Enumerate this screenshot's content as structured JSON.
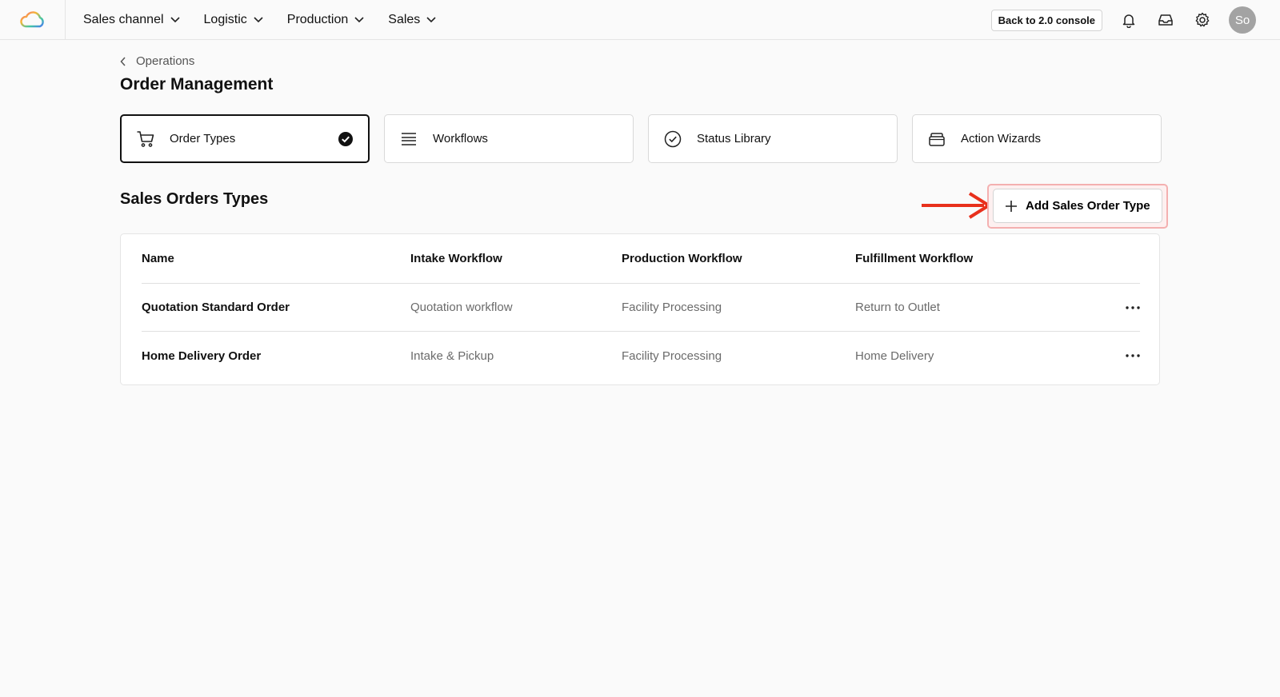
{
  "nav": {
    "items": [
      {
        "label": "Sales channel"
      },
      {
        "label": "Logistic"
      },
      {
        "label": "Production"
      },
      {
        "label": "Sales"
      }
    ],
    "console_button": "Back to 2.0 console",
    "avatar_initials": "So"
  },
  "breadcrumb": "Operations",
  "page_title": "Order Management",
  "cards": [
    {
      "label": "Order Types",
      "icon": "cart-icon",
      "active": true
    },
    {
      "label": "Workflows",
      "icon": "list-icon"
    },
    {
      "label": "Status Library",
      "icon": "check-circle-icon"
    },
    {
      "label": "Action Wizards",
      "icon": "box-icon"
    }
  ],
  "section_title": "Sales Orders Types",
  "add_button": "Add Sales Order Type",
  "table": {
    "headers": [
      "Name",
      "Intake Workflow",
      "Production Workflow",
      "Fulfillment Workflow"
    ],
    "rows": [
      [
        "Quotation Standard Order",
        "Quotation workflow",
        "Facility Processing",
        "Return to Outlet"
      ],
      [
        "Home Delivery Order",
        "Intake & Pickup",
        "Facility Processing",
        "Home Delivery"
      ]
    ]
  },
  "colors": {
    "accent_arrow": "#e8301c",
    "highlight_border": "#f4b0b0",
    "background": "#fafafa"
  }
}
